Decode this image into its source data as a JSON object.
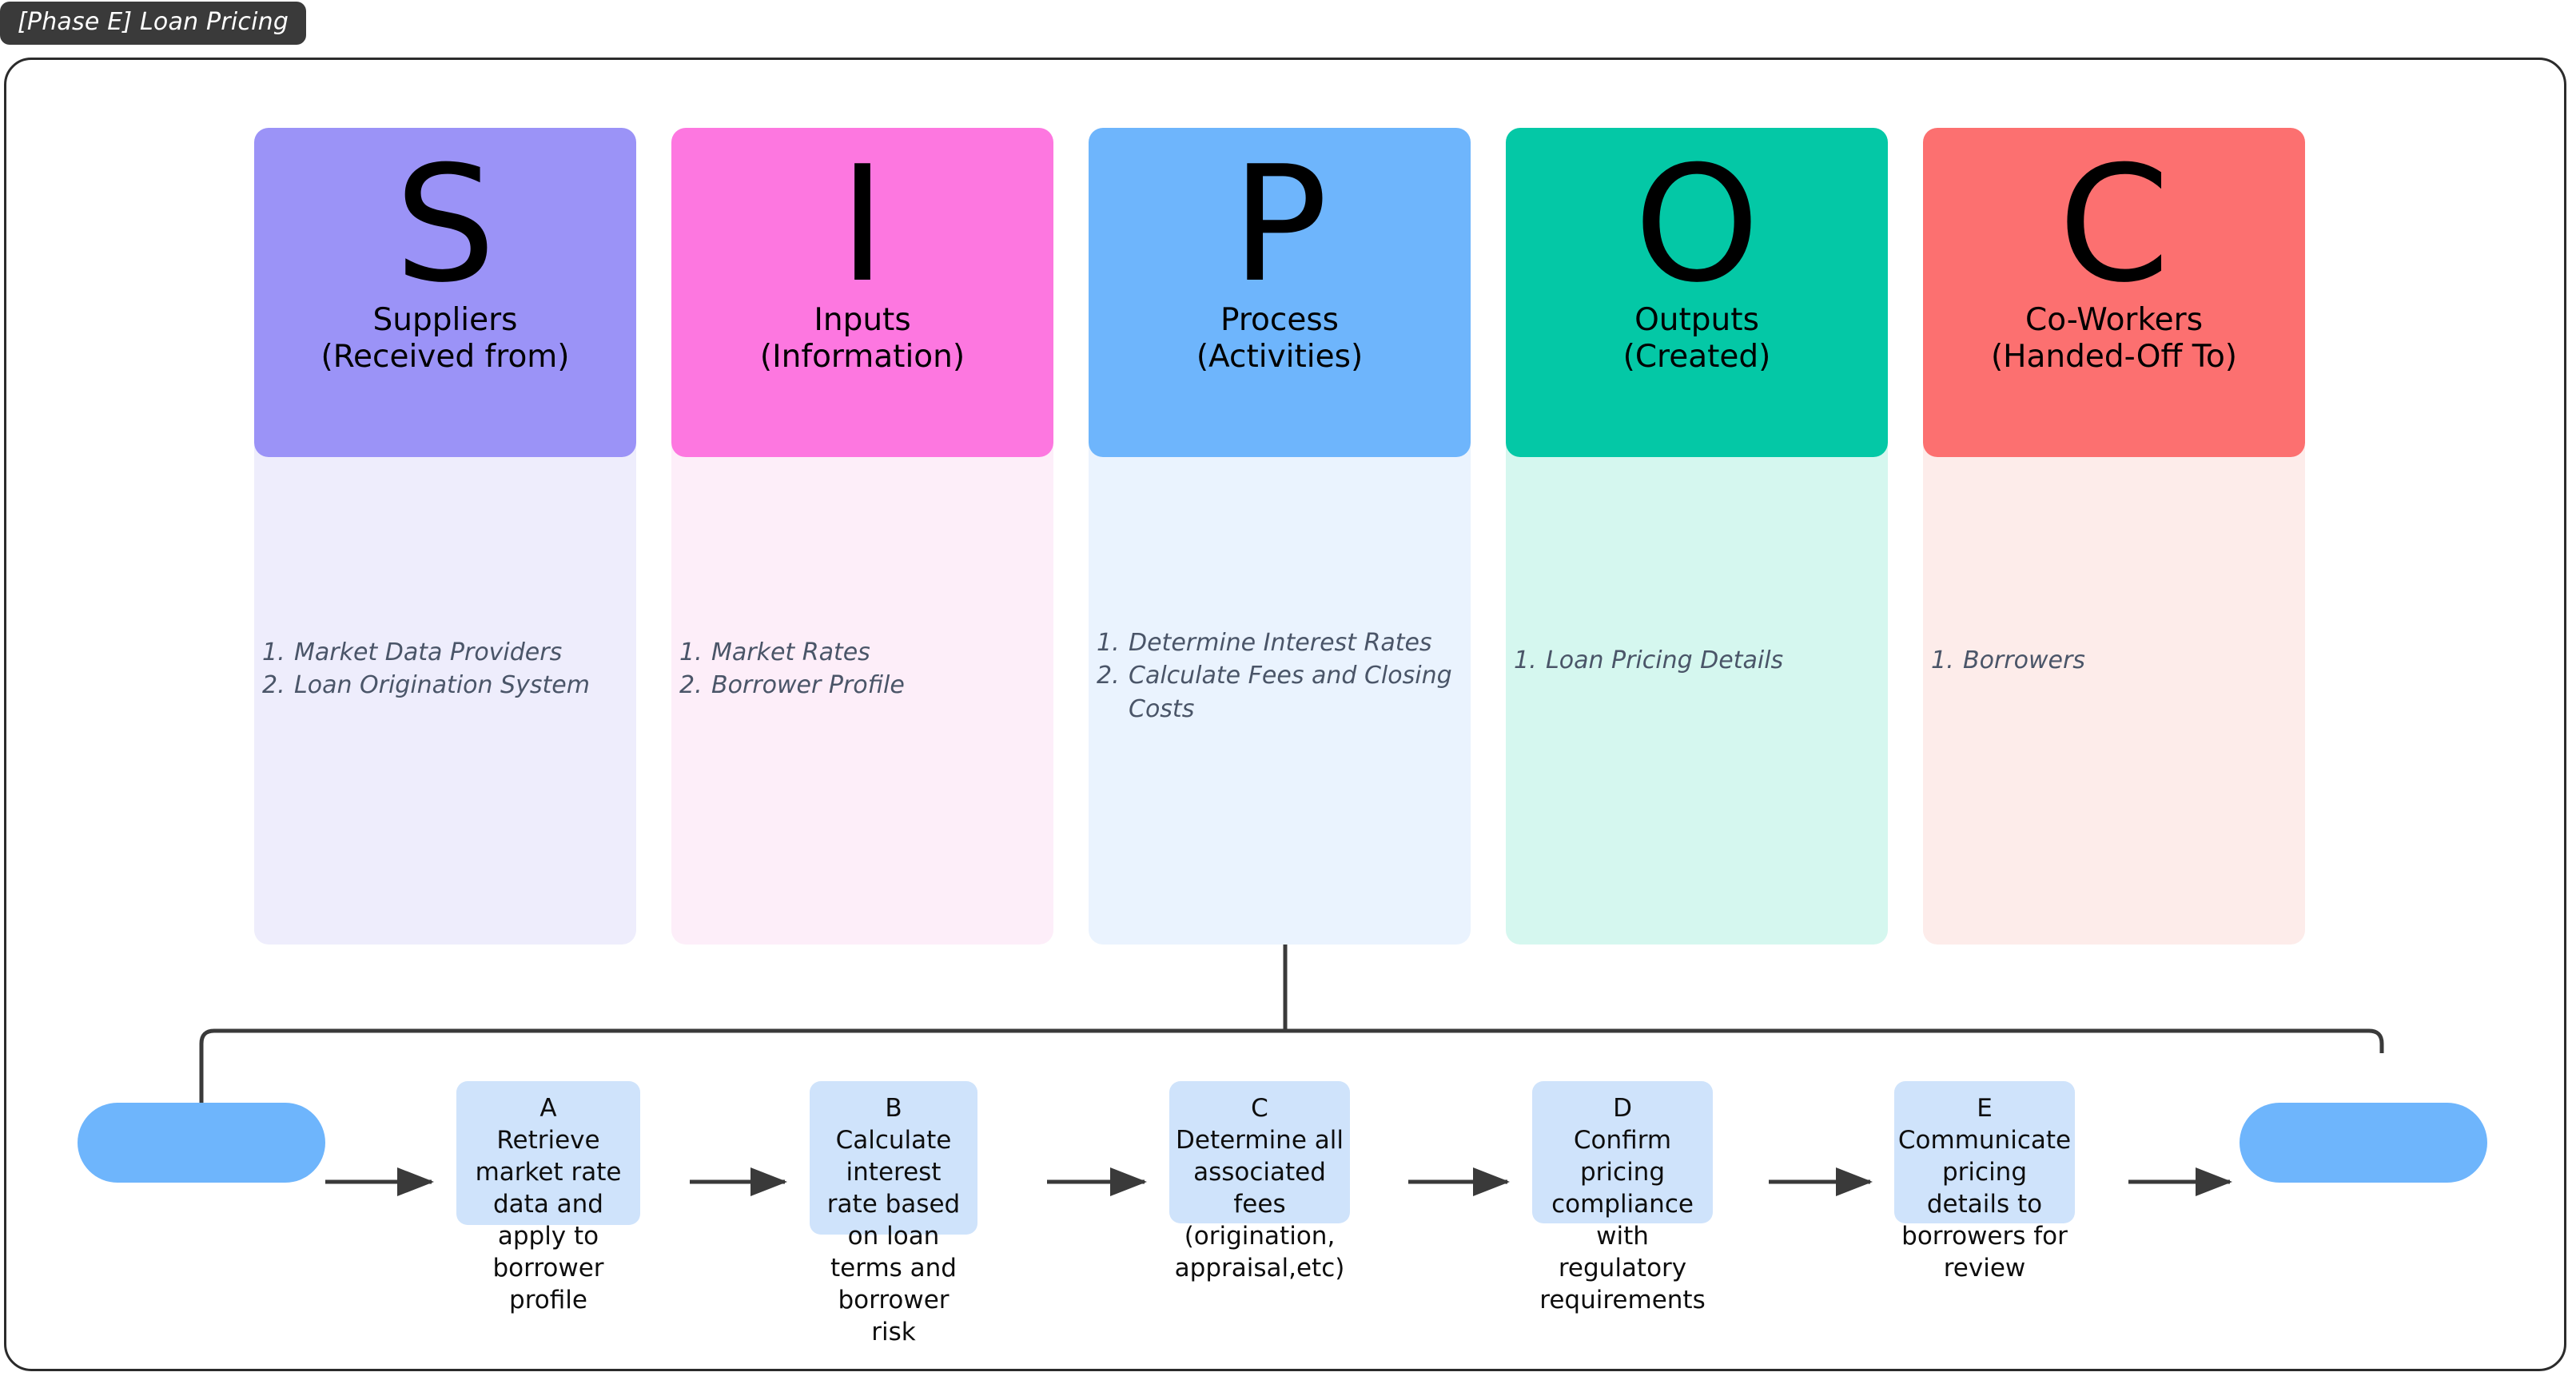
{
  "phase": {
    "badge_label": "[Phase E] Loan Pricing"
  },
  "sipoc": {
    "columns": [
      {
        "letter": "S",
        "title_line1": "Suppliers",
        "title_line2": "(Received from)",
        "header_color": "#9b93f7",
        "body_color": "#eeedfc",
        "items": [
          {
            "num": "1.",
            "text": "Market Data Providers"
          },
          {
            "num": "2.",
            "text": "Loan Origination System"
          }
        ]
      },
      {
        "letter": "I",
        "title_line1": "Inputs",
        "title_line2": "(Information)",
        "header_color": "#fd77e0",
        "body_color": "#fdeef9",
        "items": [
          {
            "num": "1.",
            "text": "Market Rates"
          },
          {
            "num": "2.",
            "text": "Borrower Profile"
          }
        ]
      },
      {
        "letter": "P",
        "title_line1": "Process",
        "title_line2": "(Activities)",
        "header_color": "#6eb5fc",
        "body_color": "#eaf3fe",
        "items": [
          {
            "num": "1.",
            "text": "Determine Interest Rates"
          },
          {
            "num": "2.",
            "text": "Calculate Fees and Closing Costs"
          }
        ]
      },
      {
        "letter": "O",
        "title_line1": "Outputs",
        "title_line2": "(Created)",
        "header_color": "#04c8a6",
        "body_color": "#d5f7ef",
        "items": [
          {
            "num": "1.",
            "text": "Loan Pricing Details"
          }
        ]
      },
      {
        "letter": "C",
        "title_line1": "Co-Workers",
        "title_line2": "(Handed-Off To)",
        "header_color": "#fc7070",
        "body_color": "#fdecea",
        "items": [
          {
            "num": "1.",
            "text": "Borrowers"
          }
        ]
      }
    ]
  },
  "flow": {
    "start_terminal_label": "",
    "end_terminal_label": "",
    "steps": [
      {
        "id": "A",
        "text": "Retrieve market rate data and apply to borrower profile"
      },
      {
        "id": "B",
        "text": "Calculate interest rate based on loan terms and borrower risk"
      },
      {
        "id": "C",
        "text": "Determine all associated fees (origination, appraisal,etc)"
      },
      {
        "id": "D",
        "text": "Confirm pricing compliance with regulatory requirements"
      },
      {
        "id": "E",
        "text": "Communicate pricing details to borrowers for review"
      }
    ]
  },
  "colors": {
    "frame_border": "#2b2b2b",
    "connector": "#3a3a3a",
    "terminal_fill": "#6eb5fc",
    "step_fill": "#cfe3fb",
    "badge_bg": "#3a3a3a",
    "list_text": "#4a5568"
  }
}
